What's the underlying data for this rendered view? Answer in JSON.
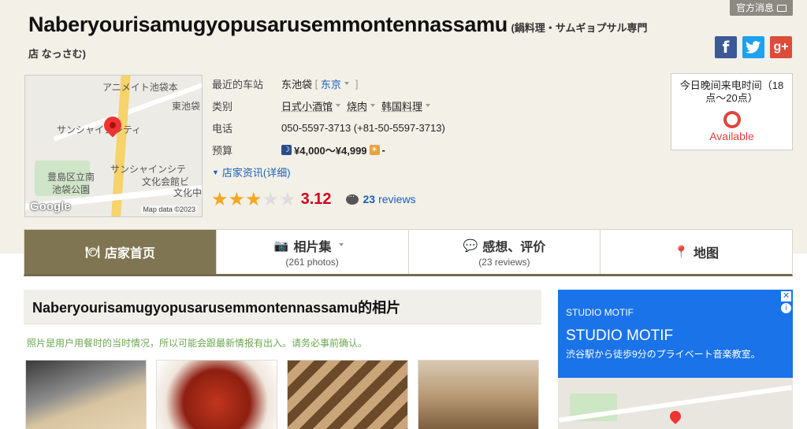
{
  "header": {
    "notice_button": "官方消息",
    "title_main": "Naberyourisamugyopusarusemmontennassamu",
    "title_sub": "(鍋料理・サムギョプサル専門",
    "title_sub2": "店 なっさむ)"
  },
  "social": {
    "facebook": "f",
    "twitter": "t",
    "googleplus": "g+"
  },
  "map": {
    "labels": [
      "アニメイト池袋本",
      "東池袋",
      "サンシャインシティ",
      "サンシャインシテ",
      "豊島区立南",
      "池袋公園",
      "文化会館ビ",
      "文化中"
    ],
    "google": "Google",
    "mapdata": "Map data ©2023"
  },
  "info": {
    "station_label": "最近的车站",
    "station_value": "东池袋",
    "station_area": "东京",
    "category_label": "类别",
    "categories": [
      "日式小酒馆",
      "烧肉",
      "韩国料理"
    ],
    "phone_label": "电话",
    "phone_value": "050-5597-3713 (+81-50-5597-3713)",
    "budget_label": "预算",
    "budget_moon_icon": "☽",
    "budget_dinner": "¥4,000～¥4,999",
    "budget_sun_icon": "☀",
    "budget_lunch": "-",
    "details_link": "店家资讯(详细)"
  },
  "rating": {
    "stars_total": 5,
    "stars_filled": 3,
    "score": "3.12",
    "review_count": "23",
    "review_word": "reviews"
  },
  "call_box": {
    "title": "今日晚间来电时间（18点～20点）",
    "status": "Available"
  },
  "tabs": [
    {
      "label": "店家首页",
      "sub": "",
      "icon": "cutlery-icon"
    },
    {
      "label": "相片集",
      "sub": "(261 photos)",
      "icon": "camera-icon"
    },
    {
      "label": "感想、评价",
      "sub": "(23 reviews)",
      "icon": "chat-icon"
    },
    {
      "label": "地图",
      "sub": "",
      "icon": "map-pin-icon"
    }
  ],
  "photos": {
    "heading": "Naberyourisamugyopusarusemmontennassamu的相片",
    "note": "照片是用户用餐时的当时情况，所以可能会跟最新情报有出入。请务必事前确认。"
  },
  "ad": {
    "small": "STUDIO MOTIF",
    "big": "STUDIO MOTIF",
    "desc": "渋谷駅から徒歩9分のプライベート音楽教室。"
  },
  "colors": {
    "band": "#f3f0e8",
    "active_tab": "#807552",
    "score_red": "#d0021b",
    "link_blue": "#1a5fb4",
    "star": "#f5a623",
    "ad_blue": "#1a73e8"
  }
}
